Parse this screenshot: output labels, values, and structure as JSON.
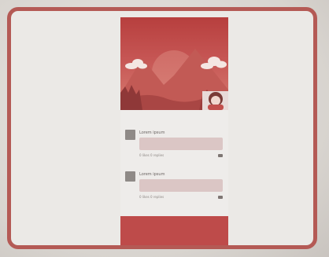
{
  "photo": {
    "colors": {
      "frame": "#b45a55",
      "accent": "#be4b4a",
      "bubble": "#dbc6c5"
    }
  },
  "feed": {
    "hero": {
      "illustration": "mountains-clouds-sun",
      "icon": "profile-avatar-icon"
    },
    "posts": [
      {
        "name": "Lorem ipsum",
        "meta": "0 likes 0 replies",
        "count": ""
      },
      {
        "name": "Lorem ipsum",
        "meta": "0 likes 0 replies",
        "count": ""
      }
    ],
    "footer": {
      "text": "",
      "background": "#be4b4a"
    }
  }
}
